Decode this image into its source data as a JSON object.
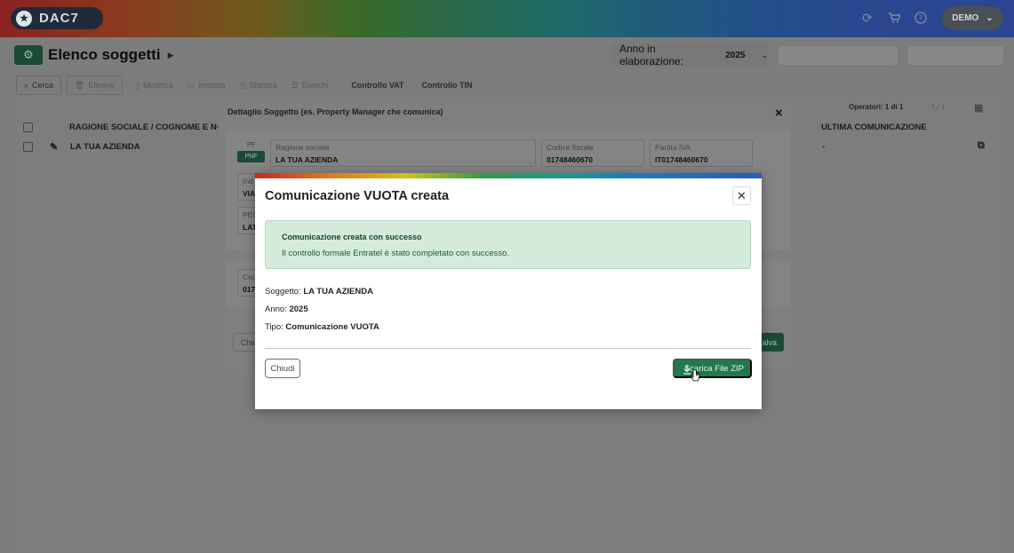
{
  "app": {
    "logo_text": "DAC7",
    "user_menu": "DEMO",
    "top_icons": [
      "refresh-icon",
      "cart-icon",
      "help-icon"
    ]
  },
  "page": {
    "title": "Elenco soggetti",
    "anno_label": "Anno in elaborazione:",
    "anno_value": "2025"
  },
  "toolbar": {
    "items": [
      "Cerca",
      "Elimina",
      "Modifica",
      "Importa",
      "Stampa",
      "Elenchi",
      "Controllo VAT",
      "Controllo TIN"
    ]
  },
  "table": {
    "operatori": "Operatori: 1 di 1",
    "pagination": "1 / 1",
    "columns": [
      "RAGIONE SOCIALE / COGNOME E NOME",
      "ULTIMA COMUNICAZIONE"
    ],
    "rows": [
      {
        "name": "LA TUA AZIENDA",
        "ultima": "-"
      }
    ]
  },
  "bg_modal": {
    "title": "Dettaglio Soggetto (es. Property Manager che comunica)",
    "pf": "PF",
    "pnf": "PNF",
    "ragione_sociale_label": "Ragione sociale",
    "ragione_sociale_value": "LA TUA AZIENDA",
    "codice_fiscale_label": "Codice fiscale",
    "codice_fiscale_value": "01748460670",
    "partita_iva_label": "Partita IVA",
    "partita_iva_value": "IT01748460670",
    "frag_ind_label": "Ind",
    "frag_ind_value": "VIA",
    "frag_pec_label": "PEC",
    "frag_pec_value": "LAT",
    "frag_cod_label": "Cod",
    "frag_cod_value": "017",
    "chiudi_frag": "Chiu",
    "salva_frag": "alva"
  },
  "dialog": {
    "title": "Comunicazione VUOTA creata",
    "alert_title": "Comunicazione creata con successo",
    "alert_text": "Il controllo formale Entratel è stato completato con successo.",
    "soggetto_label": "Soggetto:",
    "soggetto_value": "LA TUA AZIENDA",
    "anno_label": "Anno:",
    "anno_value": "2025",
    "tipo_label": "Tipo:",
    "tipo_value": "Comunicazione VUOTA",
    "chiudi_label": "Chiudi",
    "zip_label": "Scarica File ZIP"
  },
  "colors": {
    "primary_green": "#1e7a4a",
    "alert_bg": "#d4ebdc",
    "overlay": "#7c7c7c"
  }
}
